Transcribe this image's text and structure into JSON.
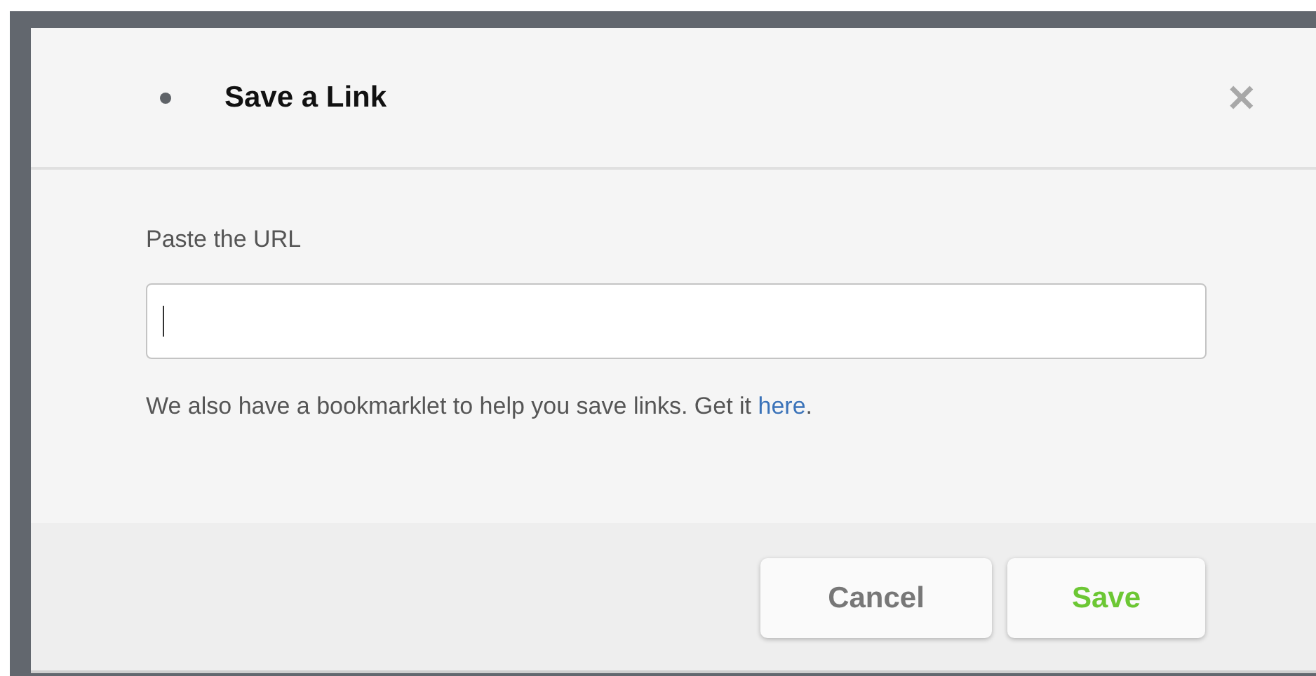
{
  "dialog": {
    "title": "Save a Link",
    "close": "✕"
  },
  "field": {
    "label": "Paste the URL",
    "focused": true
  },
  "hint": {
    "text": "We also have a bookmarklet to help you save links. Get it ",
    "link": "here",
    "end": "."
  },
  "buttons": [
    {
      "label": "Cancel",
      "kind": "secondary"
    },
    {
      "label": "Save",
      "kind": "primary"
    }
  ]
}
